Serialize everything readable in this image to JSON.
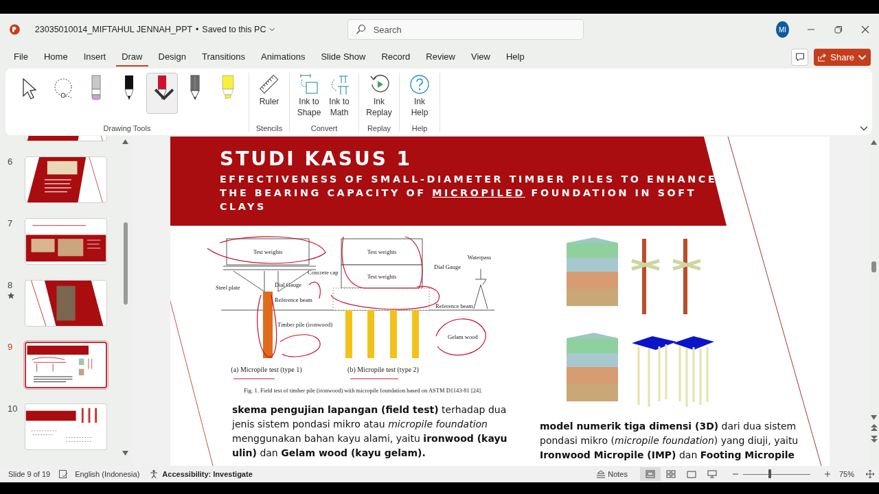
{
  "window": {
    "file_name": "23035010014_MIFTAHUL JENNAH_PPT",
    "separator": "•",
    "save_state": "Saved to this PC"
  },
  "search": {
    "placeholder": "Search"
  },
  "account": {
    "initials": "MI"
  },
  "menu_tabs": [
    {
      "label": "File",
      "selected": false
    },
    {
      "label": "Home",
      "selected": false
    },
    {
      "label": "Insert",
      "selected": false
    },
    {
      "label": "Draw",
      "selected": true
    },
    {
      "label": "Design",
      "selected": false
    },
    {
      "label": "Transitions",
      "selected": false
    },
    {
      "label": "Animations",
      "selected": false
    },
    {
      "label": "Slide Show",
      "selected": false
    },
    {
      "label": "Record",
      "selected": false
    },
    {
      "label": "Review",
      "selected": false
    },
    {
      "label": "View",
      "selected": false
    },
    {
      "label": "Help",
      "selected": false
    }
  ],
  "share_button": {
    "label": "Share"
  },
  "ribbon": {
    "groups": [
      {
        "label": "Drawing Tools",
        "tools": [
          {
            "kind": "select",
            "selected": false
          },
          {
            "kind": "lasso",
            "selected": false
          },
          {
            "kind": "eraser",
            "selected": false
          },
          {
            "kind": "pen",
            "color": "#111111",
            "selected": false
          },
          {
            "kind": "pen",
            "color": "#d0102a",
            "selected": true
          },
          {
            "kind": "pencil",
            "color": "#7a7a7a",
            "selected": false
          },
          {
            "kind": "highlighter",
            "color": "#f5f03a",
            "selected": false
          }
        ]
      },
      {
        "label": "Stencils",
        "tools": [
          {
            "kind": "ruler",
            "label": "Ruler"
          }
        ]
      },
      {
        "label": "Convert",
        "tools": [
          {
            "kind": "ink-to-shape",
            "label": "Ink to Shape"
          },
          {
            "kind": "ink-to-math",
            "label": "Ink to Math"
          }
        ]
      },
      {
        "label": "Replay",
        "tools": [
          {
            "kind": "replay",
            "label": "Ink Replay"
          }
        ]
      },
      {
        "label": "Help",
        "tools": [
          {
            "kind": "help",
            "label": "Ink Help"
          }
        ]
      }
    ]
  },
  "thumbnails": [
    {
      "kind": "diagonal",
      "selected": false,
      "animated": false
    },
    {
      "number": "6",
      "kind": "diagonal",
      "selected": false,
      "animated": false
    },
    {
      "number": "7",
      "kind": "banner",
      "selected": false,
      "animated": false
    },
    {
      "number": "8",
      "kind": "photo",
      "selected": false,
      "animated": true
    },
    {
      "number": "9",
      "kind": "figures",
      "selected": true,
      "animated": false
    },
    {
      "number": "10",
      "kind": "header",
      "selected": false,
      "animated": false
    }
  ],
  "slide": {
    "title": "STUDI KASUS 1",
    "subtitle": [
      {
        "text": "EFFECTIVENESS OF SMALL-DIAMETER TIMBER PILES TO ENHANCE THE BEARING CAPACITY OF ",
        "underlined": false
      },
      {
        "text": "MICROPILED",
        "underlined": true
      },
      {
        "text": " FOUNDATION IN SOFT CLAYS",
        "underlined": false
      }
    ],
    "field_test_figure": {
      "labels": [
        "Test weights",
        "Steel plate",
        "Concrete cap",
        "Dial Gauge",
        "Reference beam",
        "Timber pile (ironwood)",
        "Test weights",
        "Test weights",
        "Dial Gauge",
        "Reference beam",
        "Waterpass",
        "Gelam wood",
        "(a) Micropile test (type 1)",
        "(b) Micropile test (type 2)"
      ],
      "caption": "Fig. 1. Field test of timber pile (ironwood) with micropile foundation based on ASTM D1143-81 [24]."
    },
    "paragraphs": [
      "**skema pengujian lapangan (field test)** terhadap dua jenis sistem pondasi mikro atau *micropile foundation* menggunakan bahan kayu alami, yaitu **ironwood (kayu ulin)** dan **Gelam wood (kayu gelam).**",
      "**model numerik tiga dimensi (3D)** dari dua sistem pondasi mikro (*micropile foundation*) yang diuji, yaitu **Ironwood Micropile (IMP)** dan **Footing Micropile**"
    ]
  },
  "status_bar": {
    "slide_indicator": "Slide 9 of 19",
    "language": "English (Indonesia)",
    "accessibility": "Accessibility: Investigate",
    "notes": "Notes",
    "zoom": {
      "level": 0.4,
      "reading": "75%"
    }
  }
}
